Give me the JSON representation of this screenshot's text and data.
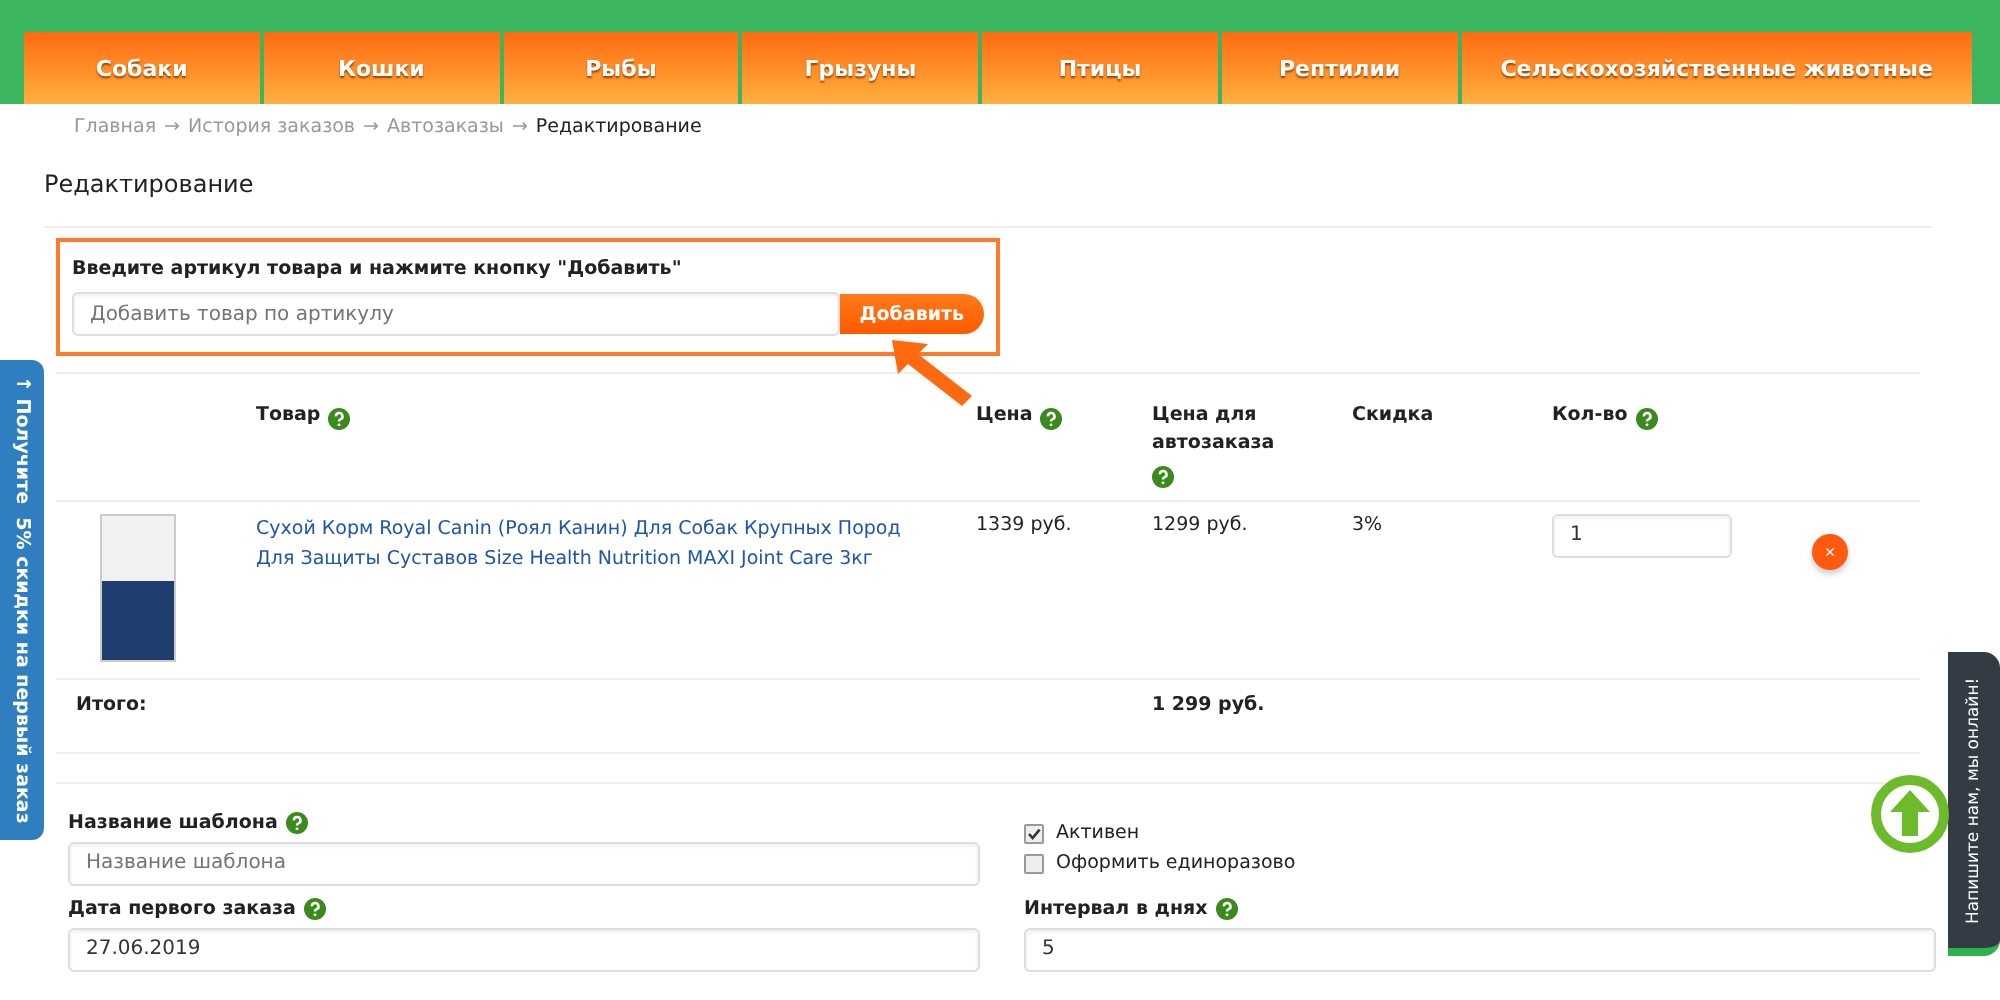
{
  "nav": [
    {
      "label": "Собаки"
    },
    {
      "label": "Кошки"
    },
    {
      "label": "Рыбы"
    },
    {
      "label": "Грызуны"
    },
    {
      "label": "Птицы"
    },
    {
      "label": "Рептилии"
    },
    {
      "label": "Сельскохозяйственные животные"
    }
  ],
  "breadcrumb": [
    {
      "label": "Главная",
      "current": false
    },
    {
      "label": "История заказов",
      "current": false
    },
    {
      "label": "Автозаказы",
      "current": false
    },
    {
      "label": "Редактирование",
      "current": true
    }
  ],
  "breadcrumb_separator": "→",
  "page_title": "Редактирование",
  "add_box": {
    "label": "Введите артикул товара и нажмите кнопку \"Добавить\"",
    "placeholder": "Добавить товар по артикулу",
    "button": "Добавить"
  },
  "table": {
    "columns": [
      {
        "label": "Товар",
        "help": true
      },
      {
        "label": "Цена",
        "help": true
      },
      {
        "label": "Цена для автозаказа",
        "help": true
      },
      {
        "label": "Скидка",
        "help": false
      },
      {
        "label": "Кол-во",
        "help": true
      }
    ],
    "rows": [
      {
        "name": "Сухой Корм Royal Canin (Роял Канин) Для Собак Крупных Пород Для Защиты Суставов Size Health Nutrition MAXI Joint Care 3кг",
        "price": "1339 руб.",
        "autoprice": "1299 руб.",
        "discount": "3%",
        "qty": "1",
        "remove": "×"
      }
    ],
    "total_label": "Итого:",
    "total": "1 299 руб."
  },
  "form": {
    "template_label": "Название шаблона",
    "template_placeholder": "Название шаблона",
    "checks": [
      {
        "label": "Активен",
        "checked": true
      },
      {
        "label": "Оформить единоразово",
        "checked": false
      }
    ],
    "date_label": "Дата первого заказа",
    "date_value": "27.06.2019",
    "interval_label": "Интервал в днях",
    "interval_value": "5"
  },
  "promo_tab": "↑ Получите  5% скидки на первый заказ",
  "chat_tab": "Напишите нам, мы онлайн!"
}
